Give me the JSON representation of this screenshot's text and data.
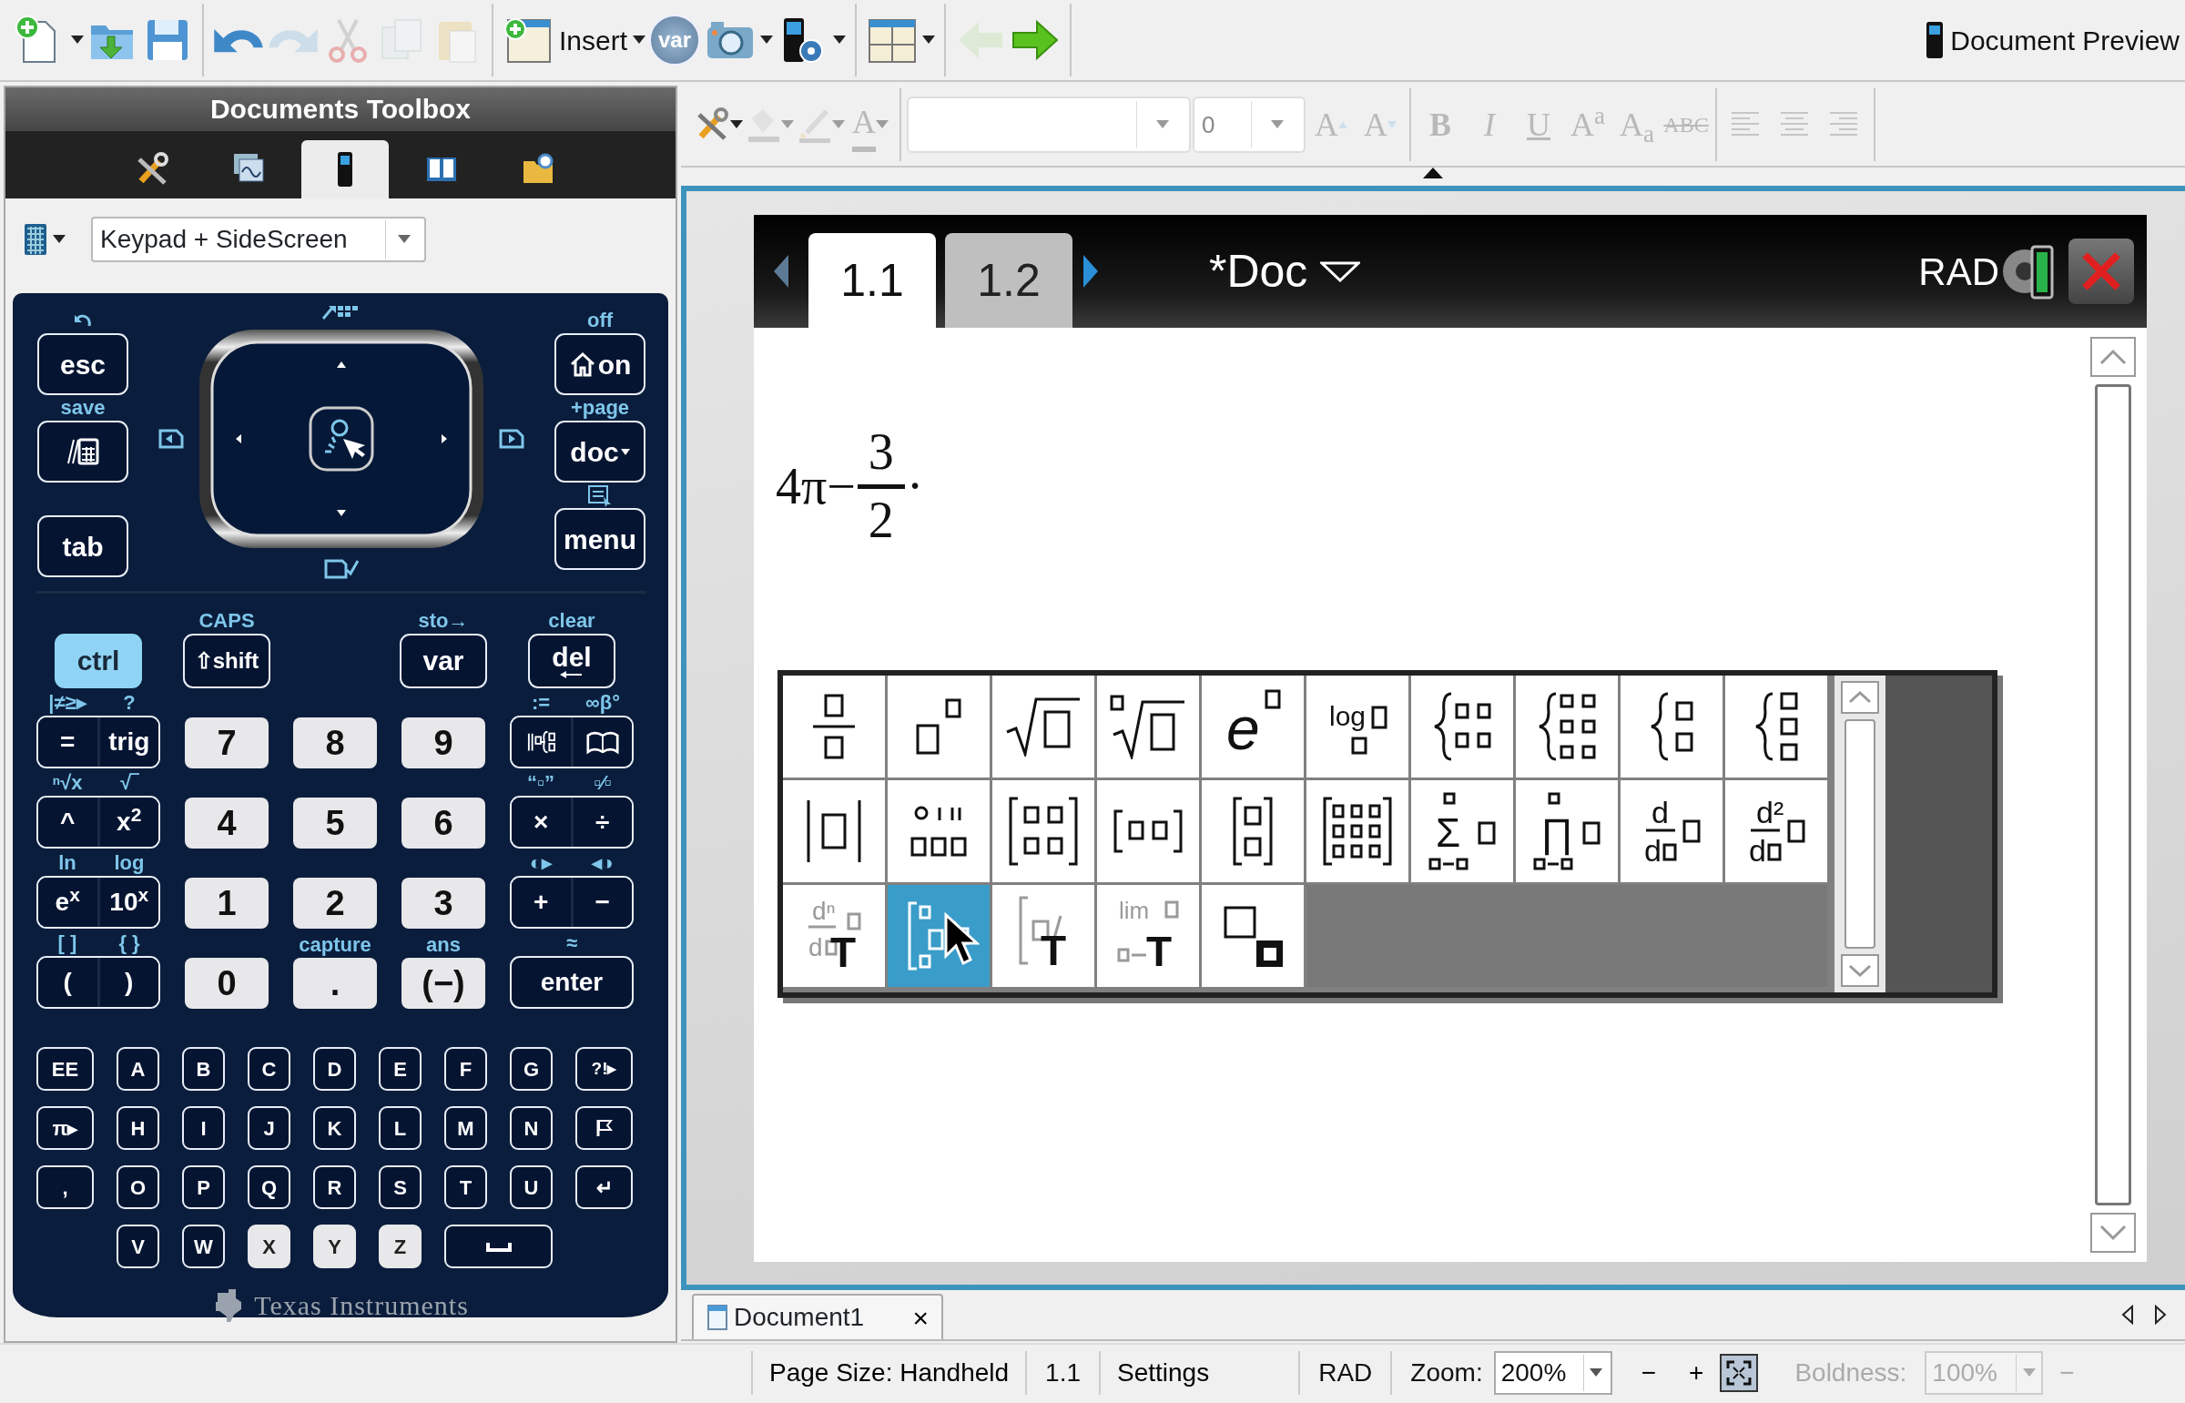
{
  "toolbar": [
    [
      {
        "kind": "new",
        "dropdown": true,
        "disabled": false
      },
      {
        "kind": "open",
        "dropdown": false,
        "disabled": false
      },
      {
        "kind": "save",
        "dropdown": false,
        "disabled": false
      }
    ],
    [
      {
        "kind": "undo",
        "dropdown": false,
        "disabled": false
      },
      {
        "kind": "redo",
        "dropdown": false,
        "disabled": true
      },
      {
        "kind": "cut",
        "dropdown": false,
        "disabled": true
      },
      {
        "kind": "copy",
        "dropdown": false,
        "disabled": true
      },
      {
        "kind": "paste",
        "dropdown": false,
        "disabled": true
      }
    ],
    [
      {
        "kind": "insert",
        "label": "Insert",
        "dropdown": true,
        "disabled": false
      },
      {
        "kind": "variable",
        "label": "var",
        "dropdown": false,
        "disabled": false
      },
      {
        "kind": "camera",
        "dropdown": true,
        "disabled": false
      },
      {
        "kind": "device",
        "dropdown": true,
        "disabled": false
      }
    ],
    [
      {
        "kind": "layout",
        "dropdown": true,
        "disabled": false
      }
    ],
    [
      {
        "kind": "back",
        "dropdown": false,
        "disabled": true
      },
      {
        "kind": "forward",
        "dropdown": false,
        "disabled": false
      }
    ]
  ],
  "preview": {
    "label": "Document Preview"
  },
  "toolbox": {
    "title": "Documents Toolbox",
    "tabs": [
      {
        "kind": "tools",
        "selected": false
      },
      {
        "kind": "pages",
        "selected": false
      },
      {
        "kind": "keypad",
        "selected": true
      },
      {
        "kind": "book",
        "selected": false
      },
      {
        "kind": "folder",
        "selected": false
      }
    ],
    "view_select": {
      "value": "Keypad + SideScreen"
    }
  },
  "calculator": {
    "nav_left": [
      {
        "label": "esc"
      },
      {
        "above": "save"
      },
      {
        "label": "tab"
      }
    ],
    "nav_right": [
      {
        "above": "off",
        "label": "on"
      },
      {
        "above": "+page",
        "label": "doc"
      },
      {
        "label": "menu"
      }
    ],
    "modifiers": [
      {
        "label": "ctrl",
        "pressed": true
      },
      {
        "label": "⇧shift",
        "above": "CAPS",
        "pressed": false
      },
      {
        "label": "var",
        "above": "sto→"
      },
      {
        "label": "del",
        "above": "clear"
      }
    ],
    "rows": [
      [
        {
          "kind": "pair",
          "keys": [
            {
              "label": "=",
              "above": "|≠≥▸"
            },
            {
              "label": "trig",
              "above": "?"
            }
          ]
        },
        {
          "kind": "light",
          "label": "7"
        },
        {
          "kind": "light",
          "label": "8"
        },
        {
          "kind": "light",
          "label": "9"
        },
        {
          "kind": "pair",
          "keys": [
            {
              "above": ":="
            },
            {
              "above": "∞β°"
            }
          ]
        }
      ],
      [
        {
          "kind": "pair",
          "keys": [
            {
              "label": "^",
              "above": "ⁿ√x"
            },
            {
              "label": "x$^{2}$",
              "above": "√‾"
            }
          ]
        },
        {
          "kind": "light",
          "label": "4"
        },
        {
          "kind": "light",
          "label": "5"
        },
        {
          "kind": "light",
          "label": "6"
        },
        {
          "kind": "pair",
          "keys": [
            {
              "label": "×",
              "above": "“▫”"
            },
            {
              "label": "÷",
              "above": "▫⁄▫"
            }
          ]
        }
      ],
      [
        {
          "kind": "pair",
          "keys": [
            {
              "label": "e$^{x}$",
              "above": "ln"
            },
            {
              "label": "10$^{x}$",
              "above": "log"
            }
          ]
        },
        {
          "kind": "light",
          "label": "1"
        },
        {
          "kind": "light",
          "label": "2"
        },
        {
          "kind": "light",
          "label": "3"
        },
        {
          "kind": "pair",
          "keys": [
            {
              "label": "+",
              "above": "◐▸"
            },
            {
              "label": "−",
              "above": "◂◑"
            }
          ]
        }
      ],
      [
        {
          "kind": "pair",
          "keys": [
            {
              "label": "(",
              "above": "[ ]"
            },
            {
              "label": ")",
              "above": "{ }"
            }
          ]
        },
        {
          "kind": "light",
          "label": "0"
        },
        {
          "kind": "light",
          "label": ".",
          "above": "capture"
        },
        {
          "kind": "light",
          "label": "(−)",
          "above": "ans"
        },
        {
          "kind": "wide",
          "label": "enter",
          "above": "≈"
        }
      ]
    ],
    "alpha_rows": [
      [
        {
          "kind": "wide",
          "label": "EE"
        },
        {
          "kind": "letter",
          "label": "A",
          "light": false
        },
        {
          "kind": "letter",
          "label": "B",
          "light": false
        },
        {
          "kind": "letter",
          "label": "C",
          "light": false
        },
        {
          "kind": "letter",
          "label": "D",
          "light": false
        },
        {
          "kind": "letter",
          "label": "E",
          "light": false
        },
        {
          "kind": "letter",
          "label": "F",
          "light": false
        },
        {
          "kind": "letter",
          "label": "G",
          "light": false
        },
        {
          "kind": "wide",
          "label": "?!▸"
        }
      ],
      [
        {
          "kind": "wide",
          "label": "π▸"
        },
        {
          "kind": "letter",
          "label": "H",
          "light": false
        },
        {
          "kind": "letter",
          "label": "I",
          "light": false
        },
        {
          "kind": "letter",
          "label": "J",
          "light": false
        },
        {
          "kind": "letter",
          "label": "K",
          "light": false
        },
        {
          "kind": "letter",
          "label": "L",
          "light": false
        },
        {
          "kind": "letter",
          "label": "M",
          "light": false
        },
        {
          "kind": "letter",
          "label": "N",
          "light": false
        },
        {
          "kind": "flag"
        }
      ],
      [
        {
          "kind": "wide",
          "label": ","
        },
        {
          "kind": "letter",
          "label": "O",
          "light": false
        },
        {
          "kind": "letter",
          "label": "P",
          "light": false
        },
        {
          "kind": "letter",
          "label": "Q",
          "light": false
        },
        {
          "kind": "letter",
          "label": "R",
          "light": false
        },
        {
          "kind": "letter",
          "label": "S",
          "light": false
        },
        {
          "kind": "letter",
          "label": "T",
          "light": false
        },
        {
          "kind": "letter",
          "label": "U",
          "light": false
        },
        {
          "kind": "wide",
          "label": "↵"
        }
      ],
      [
        {
          "kind": "letter",
          "label": "V",
          "light": false
        },
        {
          "kind": "letter",
          "label": "W",
          "light": false
        },
        {
          "kind": "letter",
          "label": "X",
          "light": true
        },
        {
          "kind": "letter",
          "label": "Y",
          "light": true
        },
        {
          "kind": "letter",
          "label": "Z",
          "light": true
        },
        {
          "kind": "space"
        }
      ]
    ],
    "brand": "Texas Instruments"
  },
  "format_bar": [
    {
      "kind": "tools",
      "dropdown": true,
      "disabled": false
    },
    {
      "kind": "fill",
      "dropdown": true,
      "disabled": true
    },
    {
      "kind": "pen",
      "dropdown": true,
      "disabled": true
    },
    {
      "kind": "font-color",
      "label": "A",
      "dropdown": true,
      "disabled": true
    },
    {
      "kind": "font-field",
      "disabled": true
    },
    {
      "kind": "size-field",
      "value": "0",
      "disabled": true
    },
    {
      "kind": "grow",
      "label": "A",
      "disabled": true
    },
    {
      "kind": "shrink",
      "label": "A",
      "disabled": true
    },
    {
      "kind": "bold",
      "label": "B",
      "disabled": true
    },
    {
      "kind": "italic",
      "label": "I",
      "disabled": true
    },
    {
      "kind": "underline",
      "label": "U",
      "disabled": true
    },
    {
      "kind": "superscript",
      "label": "A$^{a}$",
      "disabled": true
    },
    {
      "kind": "subscript",
      "label": "A$_{a}$",
      "disabled": true
    },
    {
      "kind": "strike",
      "label": "ABC",
      "disabled": true
    },
    {
      "kind": "align-left",
      "disabled": true
    },
    {
      "kind": "align-center",
      "disabled": true
    },
    {
      "kind": "align-right",
      "disabled": true
    }
  ],
  "screen": {
    "tabs": [
      {
        "label": "1.1",
        "selected": true
      },
      {
        "label": "1.2",
        "selected": false
      }
    ],
    "doc_title": "*Doc",
    "angle_mode": "RAD",
    "expression": {
      "lead": "4π−",
      "numerator": "3",
      "denominator": "2",
      "trail": "·"
    },
    "templates": [
      {
        "kind": "fraction",
        "selected": false
      },
      {
        "kind": "power",
        "selected": false
      },
      {
        "kind": "sqrt",
        "selected": false
      },
      {
        "kind": "nth_root",
        "selected": false
      },
      {
        "kind": "exp",
        "glyphs": [
          "e"
        ],
        "selected": false
      },
      {
        "kind": "log",
        "glyphs": [
          "log"
        ],
        "selected": false
      },
      {
        "kind": "piecewise2",
        "selected": false
      },
      {
        "kind": "piecewise_n",
        "selected": false
      },
      {
        "kind": "system2",
        "selected": false
      },
      {
        "kind": "system_n",
        "selected": false
      },
      {
        "kind": "abs",
        "selected": false
      },
      {
        "kind": "dms",
        "selected": false
      },
      {
        "kind": "matrix2x2",
        "selected": false
      },
      {
        "kind": "row_vector",
        "selected": false
      },
      {
        "kind": "column_vector",
        "selected": false
      },
      {
        "kind": "matrix_mxn",
        "selected": false
      },
      {
        "kind": "sum",
        "glyphs": [
          "Σ"
        ],
        "selected": false
      },
      {
        "kind": "product",
        "glyphs": [
          "∏"
        ],
        "selected": false
      },
      {
        "kind": "derivative",
        "glyphs": [
          "d",
          "d"
        ],
        "selected": false
      },
      {
        "kind": "derivative",
        "glyphs": [
          "d²",
          "d"
        ],
        "selected": false
      },
      {
        "kind": "nth_derivative",
        "glyphs": [
          "dⁿ",
          "d",
          "T"
        ],
        "selected": false
      },
      {
        "kind": "integral",
        "selected": true
      },
      {
        "kind": "indefinite_integral",
        "glyphs": [
          "T"
        ],
        "selected": false
      },
      {
        "kind": "limit",
        "glyphs": [
          "lim",
          "T"
        ],
        "selected": false
      },
      {
        "kind": "subscript",
        "selected": false
      }
    ]
  },
  "document_tabs": [
    {
      "label": "Document1",
      "close": "×"
    }
  ],
  "status_bar": {
    "page_size": "Page Size: Handheld",
    "page": "1.1",
    "settings": "Settings",
    "angle_mode": "RAD",
    "zoom_label": "Zoom:",
    "zoom": "200%",
    "zoom_out": "−",
    "zoom_in": "+",
    "fit_pressed": true,
    "boldness_label": "Boldness:",
    "boldness": "100%",
    "boldness_minus": "−",
    "boldness_disabled": true
  }
}
